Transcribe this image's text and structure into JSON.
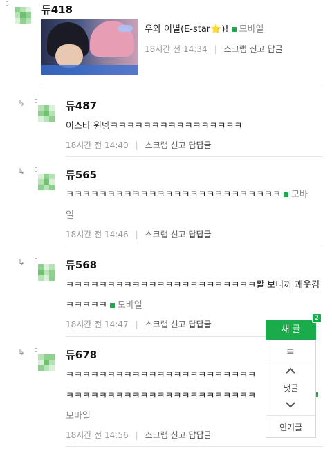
{
  "comments": [
    {
      "nick": "듀418",
      "text": "우와 이별(E-star",
      "emoji": "⭐",
      "text_end": ")!",
      "mobile": "모바일",
      "time": "18시간 전 14:34",
      "scrap": "스크랩",
      "report": "신고",
      "reply": "답글"
    },
    {
      "nick": "듀487",
      "text": "이스타 윈뎅ㅋㅋㅋㅋㅋㅋㅋㅋㅋㅋㅋㅋㅋㅋㅋㅋ",
      "time": "18시간 전 14:40",
      "scrap": "스크랩",
      "report": "신고",
      "reply": "답답글"
    },
    {
      "nick": "듀565",
      "text_line1": "ㅋㅋㅋㅋㅋㅋㅋㅋㅋㅋㅋㅋㅋㅋㅋㅋㅋㅋㅋㅋㅋㅋㅋㅋㅋㅋ",
      "mobile_a": "모바",
      "mobile_b": "일",
      "time": "18시간 전 14:46",
      "scrap": "스크랩",
      "report": "신고",
      "reply": "답답글"
    },
    {
      "nick": "듀568",
      "text_line1": "ㅋㅋㅋㅋㅋㅋㅋㅋㅋㅋㅋㅋㅋㅋㅋㅋㅋㅋㅋㅋㅋㅋㅋ짤 보니까 괘웃김",
      "text_line2": "ㅋㅋㅋㅋㅋ",
      "mobile": "모바일",
      "time": "18시간 전 14:47",
      "scrap": "스크랩",
      "report": "신고",
      "reply": "답답글"
    },
    {
      "nick": "듀678",
      "text_line1": "ㅋㅋㅋㅋㅋㅋㅋㅋㅋㅋㅋㅋㅋㅋㅋㅋㅋㅋㅋㅋㅋㅋㅋ",
      "text_line2": "ㅋㅋㅋㅋㅋㅋㅋㅋㅋㅋㅋㅋㅋㅋㅋㅋㅋㅋㅋㅋㅋㅋㅋ",
      "mobile": "모바일",
      "time": "18시간 전 14:56",
      "scrap": "스크랩",
      "report": "신고",
      "reply": "답답글"
    }
  ],
  "floating_menu": {
    "new_post": "새 글",
    "badge": "2",
    "menu_glyph": "≡",
    "comments": "댓글",
    "popular": "인기글"
  },
  "colors": {
    "accent": "#1aab4b",
    "meta": "#999999",
    "divider": "#e5e5e5"
  }
}
